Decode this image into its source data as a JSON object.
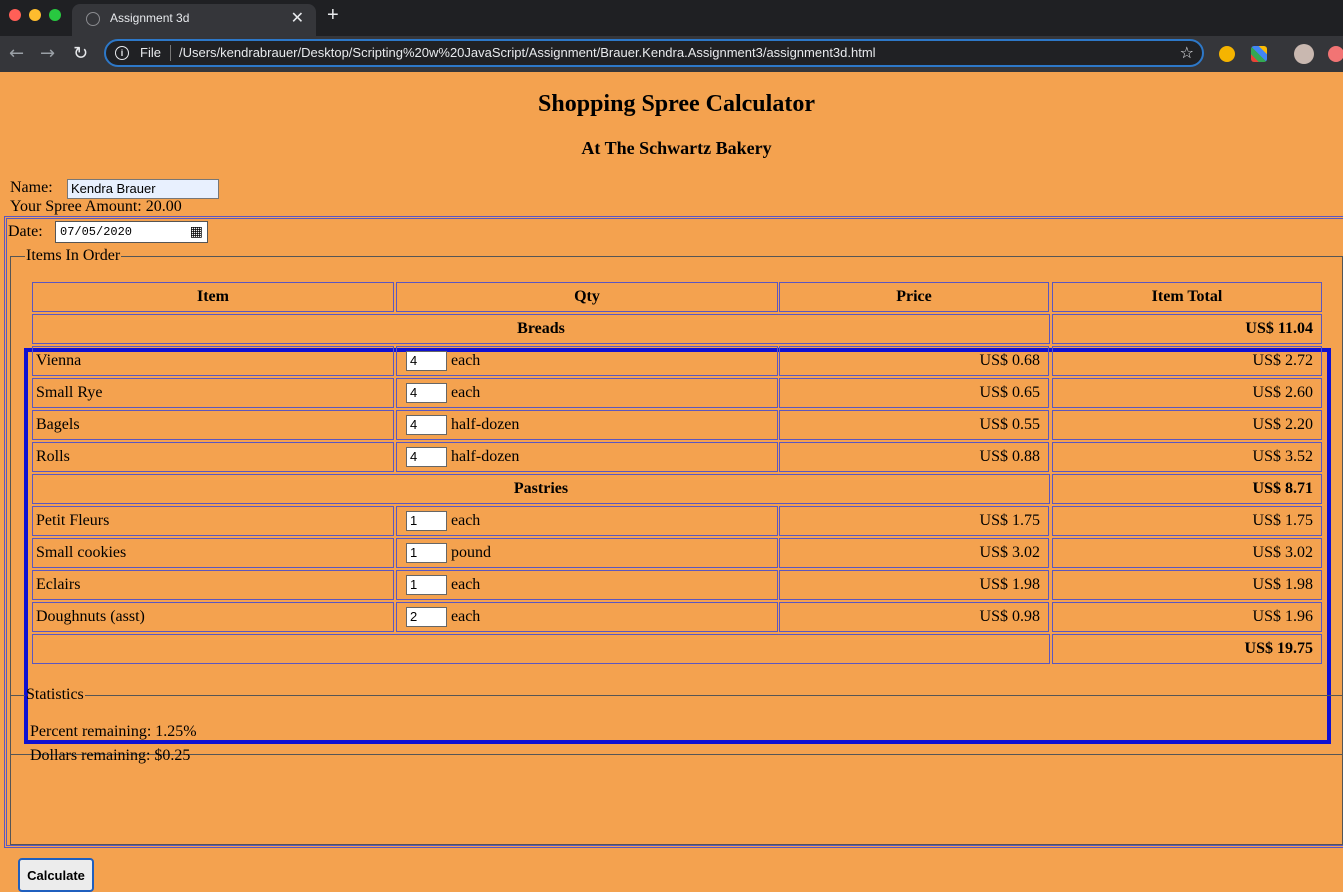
{
  "browser": {
    "tab_title": "Assignment 3d",
    "close_glyph": "✕",
    "new_tab_glyph": "+",
    "scheme_label": "File",
    "url": "/Users/kendrabrauer/Desktop/Scripting%20w%20JavaScript/Assignment/Brauer.Kendra.Assignment3/assignment3d.html"
  },
  "page": {
    "title": "Shopping Spree Calculator",
    "subtitle": "At The Schwartz Bakery",
    "name_label": "Name:",
    "name_value": "Kendra Brauer",
    "spree_text": "Your Spree Amount: 20.00",
    "date_label": "Date:",
    "date_value": "07/05/2020"
  },
  "items_fieldset": {
    "legend": "Items In Order"
  },
  "table": {
    "headers": [
      "Item",
      "Qty",
      "Price",
      "Item Total"
    ],
    "groups": [
      {
        "name": "Breads",
        "total": "US$ 11.04",
        "rows": [
          {
            "item": "Vienna",
            "qty": "4",
            "unit": "each",
            "price": "US$ 0.68",
            "total": "US$ 2.72"
          },
          {
            "item": "Small Rye",
            "qty": "4",
            "unit": "each",
            "price": "US$ 0.65",
            "total": "US$ 2.60"
          },
          {
            "item": "Bagels",
            "qty": "4",
            "unit": "half-dozen",
            "price": "US$ 0.55",
            "total": "US$ 2.20"
          },
          {
            "item": "Rolls",
            "qty": "4",
            "unit": "half-dozen",
            "price": "US$ 0.88",
            "total": "US$ 3.52"
          }
        ]
      },
      {
        "name": "Pastries",
        "total": "US$ 8.71",
        "rows": [
          {
            "item": "Petit Fleurs",
            "qty": "1",
            "unit": "each",
            "price": "US$ 1.75",
            "total": "US$ 1.75"
          },
          {
            "item": "Small cookies",
            "qty": "1",
            "unit": "pound",
            "price": "US$ 3.02",
            "total": "US$ 3.02"
          },
          {
            "item": "Eclairs",
            "qty": "1",
            "unit": "each",
            "price": "US$ 1.98",
            "total": "US$ 1.98"
          },
          {
            "item": "Doughnuts (asst)",
            "qty": "2",
            "unit": "each",
            "price": "US$ 0.98",
            "total": "US$ 1.96"
          }
        ]
      }
    ],
    "grand_total": "US$ 19.75"
  },
  "statistics": {
    "legend": "Statistics",
    "percent_remaining": "Percent remaining: 1.25%",
    "dollars_remaining": "Dollars remaining: $0.25"
  },
  "calculate_label": "Calculate",
  "colors": {
    "page_background": "#f4a24f",
    "table_border": "#1010d0",
    "cell_border": "#5b57c0"
  }
}
